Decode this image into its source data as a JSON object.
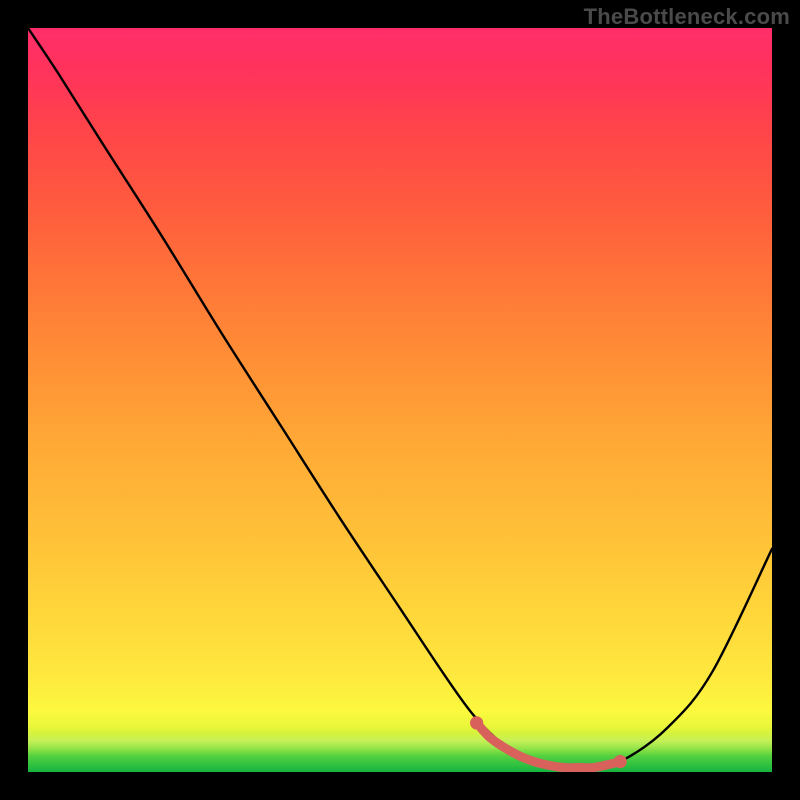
{
  "watermark": "TheBottleneck.com",
  "chart_data": {
    "type": "line",
    "title": "",
    "xlabel": "",
    "ylabel": "",
    "xlim": [
      0,
      100
    ],
    "ylim": [
      0,
      100
    ],
    "grid": false,
    "legend": false,
    "series": [
      {
        "name": "bottleneck-curve",
        "x": [
          0,
          4,
          10,
          18,
          26,
          34,
          42,
          50,
          56,
          60,
          64,
          68,
          72,
          76,
          80,
          86,
          92,
          100
        ],
        "y": [
          100,
          94,
          84.5,
          72,
          59,
          46.5,
          34,
          22,
          13,
          7.5,
          3.6,
          1.4,
          0.6,
          0.6,
          1.6,
          6.0,
          13.5,
          30
        ]
      }
    ],
    "highlight_segment": {
      "name": "bottleneck-trough",
      "x": [
        60.3,
        62,
        64,
        66,
        68,
        70,
        72,
        74,
        76,
        78,
        79.6
      ],
      "y": [
        6.6,
        4.7,
        3.3,
        2.2,
        1.4,
        0.9,
        0.6,
        0.6,
        0.6,
        1.0,
        1.4
      ]
    },
    "highlight_endpoints": [
      {
        "x": 60.3,
        "y": 6.6
      },
      {
        "x": 79.6,
        "y": 1.4
      }
    ],
    "colors": {
      "curve": "#000000",
      "highlight": "#d8615c",
      "background_top": "#ff2e6a",
      "background_bottom": "#14b440"
    }
  }
}
